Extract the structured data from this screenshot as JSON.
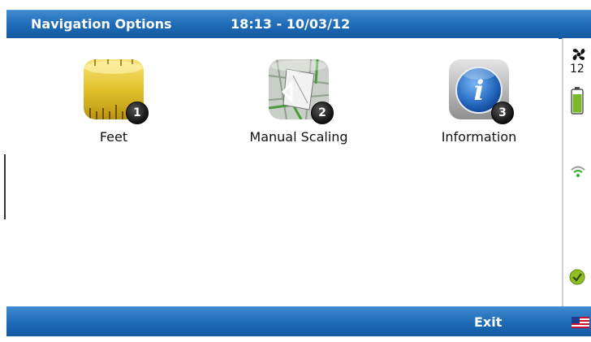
{
  "header": {
    "title": "Navigation Options",
    "datetime": "18:13 - 10/03/12"
  },
  "options": [
    {
      "label": "Feet",
      "badge": "1",
      "icon": "ruler-icon"
    },
    {
      "label": "Manual Scaling",
      "badge": "2",
      "icon": "map-scaling-icon"
    },
    {
      "label": "Information",
      "badge": "3",
      "icon": "info-icon"
    }
  ],
  "status": {
    "fan_value": "12",
    "icons": [
      "fan-icon",
      "battery-icon",
      "wifi-icon",
      "ok-check-icon"
    ]
  },
  "footer": {
    "exit_label": "Exit",
    "locale_icon": "us-flag-icon"
  },
  "colors": {
    "bar_blue": "#1f6cb8",
    "battery_green": "#79b82b"
  }
}
